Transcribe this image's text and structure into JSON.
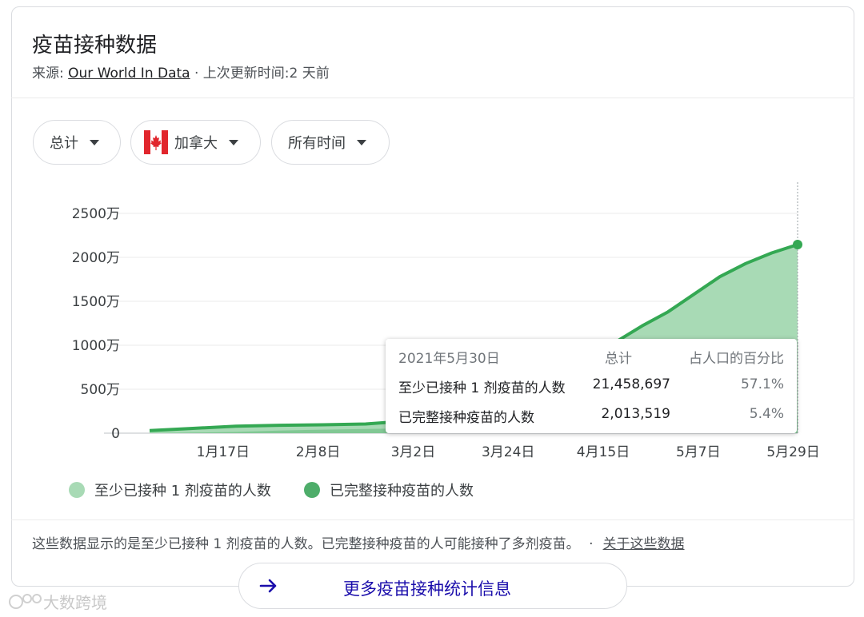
{
  "header": {
    "title": "疫苗接种数据",
    "source_prefix": "来源:",
    "source_link": "Our World In Data",
    "updated": " · 上次更新时间:2 天前"
  },
  "filters": [
    {
      "label": "总计"
    },
    {
      "label": "加拿大",
      "icon": "canada-flag-icon"
    },
    {
      "label": "所有时间"
    }
  ],
  "tooltip": {
    "date": "2021年5月30日",
    "col_total": "总计",
    "col_pct": "占人口的百分比",
    "rows": [
      {
        "label": "至少已接种 1 剂疫苗的人数",
        "total": "21,458,697",
        "pct": "57.1%"
      },
      {
        "label": "已完整接种疫苗的人数",
        "total": "2,013,519",
        "pct": "5.4%"
      }
    ]
  },
  "legend": [
    {
      "label": "至少已接种 1 剂疫苗的人数",
      "color": "#a8dab5"
    },
    {
      "label": "已完整接种疫苗的人数",
      "color": "#4ead6a"
    }
  ],
  "footer": {
    "note": "这些数据显示的是至少已接种 1 剂疫苗的人数。已完整接种疫苗的人可能接种了多剂疫苗。",
    "sep": "·",
    "about_link": "关于这些数据",
    "more_button": "更多疫苗接种统计信息"
  },
  "watermark": "大数跨境",
  "chart_data": {
    "type": "area",
    "ylim": [
      0,
      25000000
    ],
    "yticks": [
      0,
      5000000,
      10000000,
      15000000,
      20000000,
      25000000
    ],
    "ytick_labels": [
      "0",
      "500万",
      "1000万",
      "1500万",
      "2000万",
      "2500万"
    ],
    "xticks": [
      {
        "day": 17,
        "label": "1月17日"
      },
      {
        "day": 39,
        "label": "2月8日"
      },
      {
        "day": 61,
        "label": "3月2日"
      },
      {
        "day": 83,
        "label": "3月24日"
      },
      {
        "day": 105,
        "label": "4月15日"
      },
      {
        "day": 127,
        "label": "5月7日"
      },
      {
        "day": 149,
        "label": "5月29日"
      }
    ],
    "xlim": [
      -5,
      150
    ],
    "series": [
      {
        "name": "至少已接种 1 剂疫苗的人数",
        "color": "#a8dab5",
        "line_color": "#34a853",
        "x": [
          0,
          10,
          20,
          30,
          40,
          50,
          60,
          66,
          72,
          78,
          84,
          90,
          96,
          102,
          108,
          114,
          120,
          126,
          132,
          138,
          144,
          150
        ],
        "y": [
          300000,
          550000,
          800000,
          900000,
          950000,
          1050000,
          1400000,
          1800000,
          2400000,
          3200000,
          4200000,
          5500000,
          7000000,
          8700000,
          10400000,
          12200000,
          13800000,
          15800000,
          17800000,
          19300000,
          20500000,
          21458697
        ]
      },
      {
        "name": "已完整接种疫苗的人数",
        "color": "#7cc590",
        "line_color": "#7cc590",
        "x": [
          0,
          10,
          20,
          30,
          40,
          50,
          60,
          70,
          80,
          90,
          100,
          110,
          120,
          130,
          140,
          150
        ],
        "y": [
          0,
          60000,
          150000,
          300000,
          400000,
          480000,
          550000,
          650000,
          800000,
          950000,
          1100000,
          1250000,
          1450000,
          1650000,
          1850000,
          2013519
        ]
      }
    ]
  }
}
